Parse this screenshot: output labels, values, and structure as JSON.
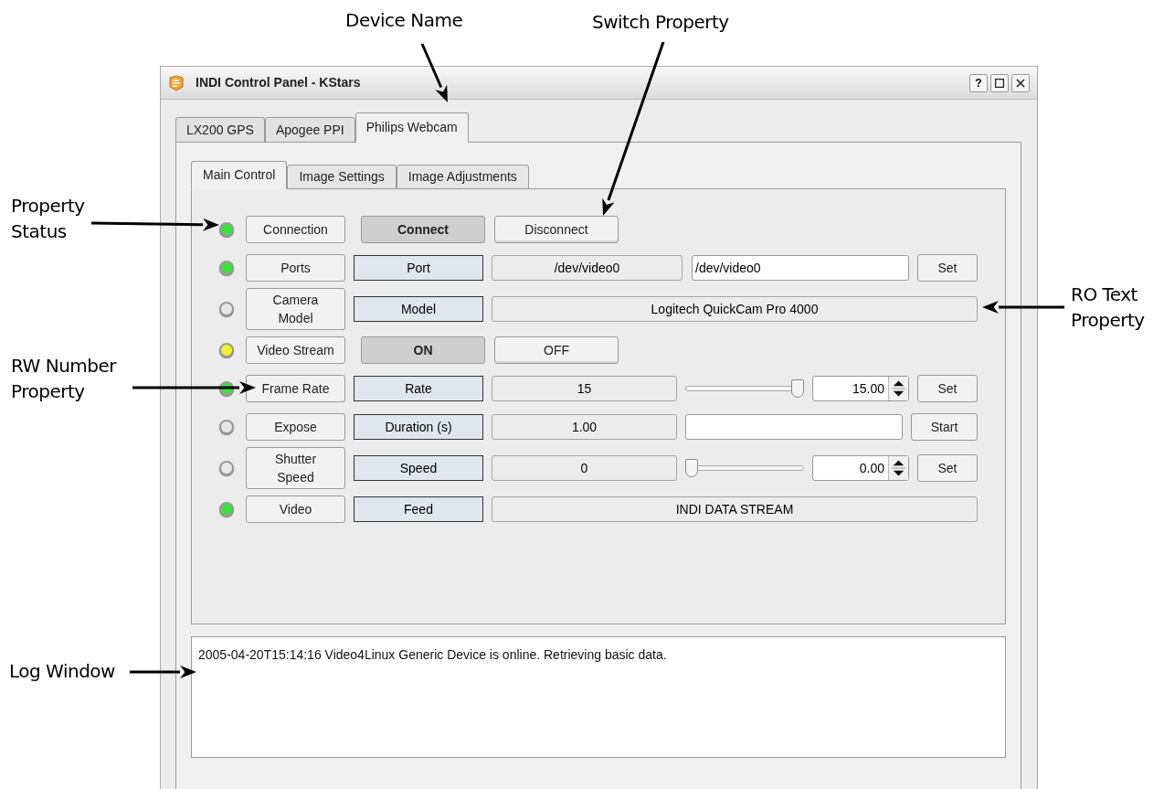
{
  "annotations": [
    {
      "text": "Device Name"
    },
    {
      "text": "Switch Property"
    },
    {
      "text": "Property Status"
    },
    {
      "text": "RO Text Property"
    },
    {
      "text": "RW Number Property"
    },
    {
      "text": "Log Window"
    }
  ],
  "window": {
    "title": "INDI Control Panel - KStars",
    "help_button": "?"
  },
  "device_tabs": [
    {
      "label": "LX200 GPS",
      "selected": false
    },
    {
      "label": "Apogee PPI",
      "selected": false
    },
    {
      "label": "Philips Webcam",
      "selected": true
    }
  ],
  "group_tabs": [
    {
      "label": "Main Control",
      "selected": true
    },
    {
      "label": "Image Settings",
      "selected": false
    },
    {
      "label": "Image Adjustments",
      "selected": false
    }
  ],
  "properties": [
    {
      "kind": "switch",
      "name": "Connection",
      "color": "#3ee03e",
      "buttons": [
        {
          "label": "Connect",
          "selected": true
        },
        {
          "label": "Disconnect",
          "selected": false
        }
      ]
    },
    {
      "kind": "text",
      "name": "Ports",
      "color": "#3ee03e",
      "element": "Port",
      "current": "/dev/video0",
      "value": "/dev/video0",
      "button": "Set"
    },
    {
      "kind": "readonly",
      "name": "Camera Model",
      "color": "#e8e8e8",
      "element": "Model",
      "current": "Logitech QuickCam Pro 4000"
    },
    {
      "kind": "switch",
      "name": "Video Stream",
      "color": "#f4f030",
      "buttons": [
        {
          "label": "ON",
          "selected": true
        },
        {
          "label": "OFF",
          "selected": false
        }
      ]
    },
    {
      "kind": "number",
      "name": "Frame Rate",
      "color": "#3ee03e",
      "element": "Rate",
      "current": "15",
      "level": 1,
      "value": "15.00",
      "button": "Set"
    },
    {
      "kind": "upload",
      "name": "Expose",
      "color": "#e8e8e8",
      "element": "Duration (s)",
      "current": "1.00",
      "button": "Start"
    },
    {
      "kind": "number",
      "name": "Shutter Speed",
      "color": "#e8e8e8",
      "element": "Speed",
      "current": "0",
      "level": 0,
      "value": "0.00",
      "button": "Set"
    },
    {
      "kind": "readonly",
      "name": "Video",
      "color": "#3ee03e",
      "element": "Feed",
      "current": "INDI DATA STREAM"
    }
  ],
  "log": "2005-04-20T15:14:16 Video4Linux Generic Device is online. Retrieving basic data."
}
